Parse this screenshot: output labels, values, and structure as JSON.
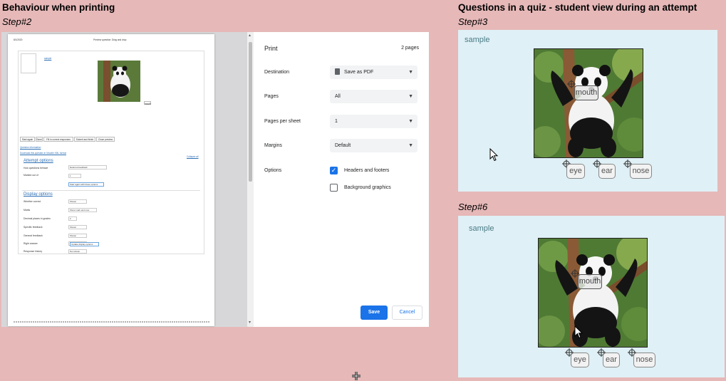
{
  "left": {
    "heading": "Behaviour when printing",
    "step": "Step#2",
    "print_dialog": {
      "title": "Print",
      "pages_count": "2 pages",
      "destination_label": "Destination",
      "destination_value": "Save as PDF",
      "pages_label": "Pages",
      "pages_value": "All",
      "pages_per_sheet_label": "Pages per sheet",
      "pages_per_sheet_value": "1",
      "margins_label": "Margins",
      "margins_value": "Default",
      "options_label": "Options",
      "headers_footers_label": "Headers and footers",
      "headers_footers_checked": true,
      "background_graphics_label": "Background graphics",
      "background_graphics_checked": false,
      "save_label": "Save",
      "cancel_label": "Cancel",
      "accent_color": "#1a73e8"
    },
    "preview": {
      "header_left": "8/1/2020",
      "header_center": "Preview question: Drag and drop",
      "sample_link": "sample",
      "mini_labels": [
        "mouth"
      ],
      "buttons": [
        "Start again",
        "Save",
        "Fill in correct responses",
        "Submit and finish",
        "Close preview"
      ],
      "question_info_link": "Question information",
      "download_link": "Download this question in Moodle XML format",
      "collapse_link": "Collapse all",
      "attempt_options": "Attempt options",
      "attempt_rows": [
        {
          "label": "How questions behave",
          "value": "Deferred feedback"
        },
        {
          "label": "Marked out of",
          "value": "1"
        }
      ],
      "attempt_button": "Start again with these options",
      "display_options": "Display options",
      "display_rows": [
        {
          "label": "Whether correct",
          "value": "Shown"
        },
        {
          "label": "Marks",
          "value": "Show mark and max"
        },
        {
          "label": "Decimal places in grades",
          "value": "2"
        },
        {
          "label": "Specific feedback",
          "value": "Shown"
        },
        {
          "label": "General feedback",
          "value": "Shown"
        },
        {
          "label": "Right answer",
          "value": "Shown"
        },
        {
          "label": "Response history",
          "value": "Not shown"
        }
      ],
      "display_button": "Update display options"
    }
  },
  "right": {
    "heading": "Questions in a quiz - student view during an attempt",
    "step3": "Step#3",
    "step6": "Step#6",
    "panel3": {
      "label": "sample",
      "placed_label": "mouth",
      "drag_items": [
        "eye",
        "ear",
        "nose"
      ]
    },
    "panel6": {
      "label": "sample",
      "placed_label": "mouth",
      "drag_items": [
        "eye",
        "ear",
        "nose"
      ]
    }
  }
}
